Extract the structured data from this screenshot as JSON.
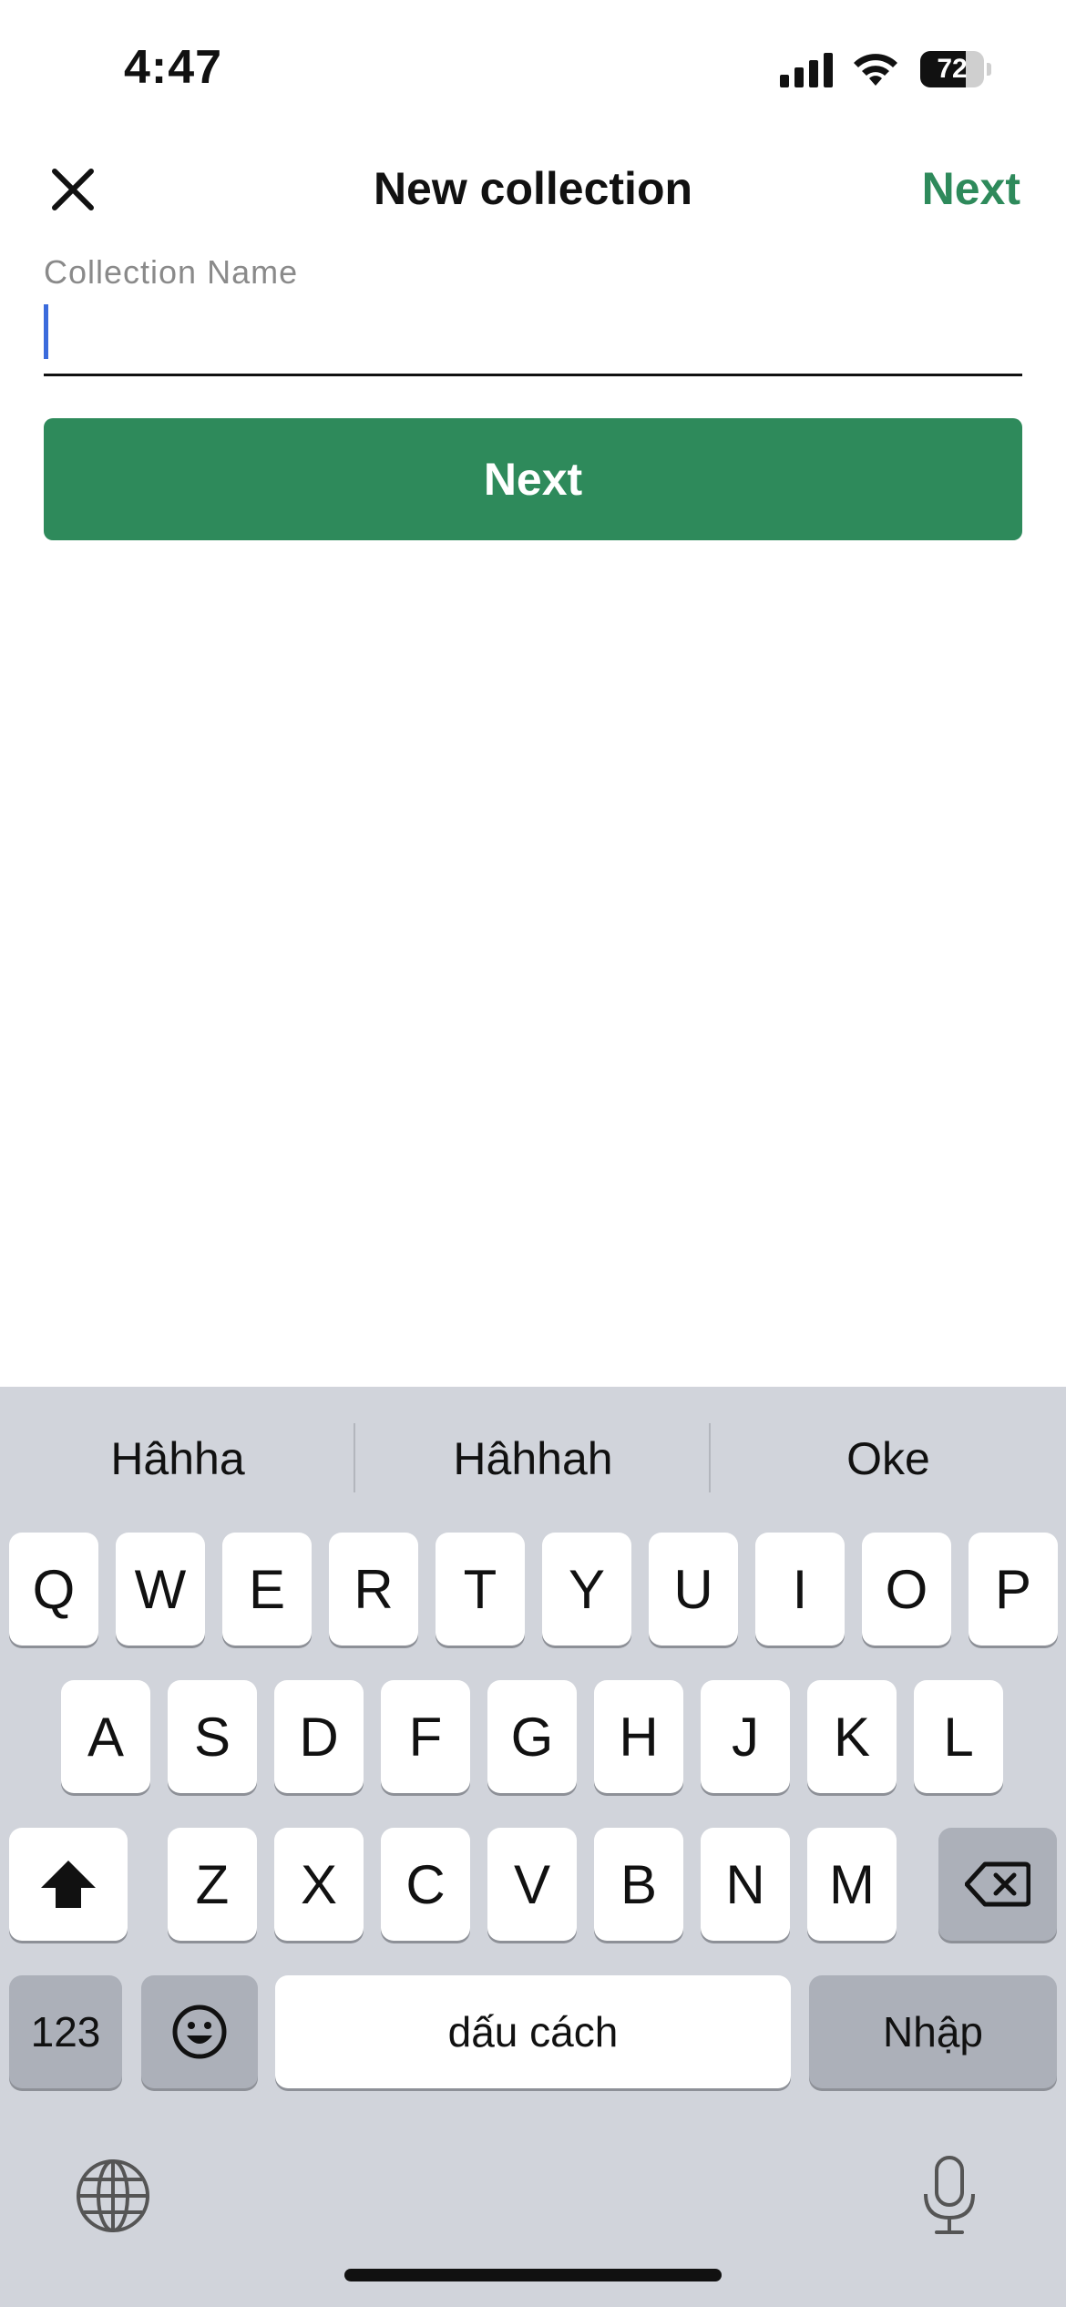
{
  "status_bar": {
    "time": "4:47",
    "battery_level": "72",
    "battery_fraction": 0.72
  },
  "nav": {
    "close_icon": "close-icon",
    "title": "New collection",
    "next_label": "Next"
  },
  "form": {
    "field_label": "Collection Name",
    "field_value": "",
    "button_label": "Next"
  },
  "colors": {
    "brand_green": "#2e8a5b",
    "caret_blue": "#3b6bdc",
    "keyboard_bg": "#d1d4db"
  },
  "keyboard": {
    "suggestions": [
      "Hâhha",
      "Hâhhah",
      "Oke"
    ],
    "row1": [
      "Q",
      "W",
      "E",
      "R",
      "T",
      "Y",
      "U",
      "I",
      "O",
      "P"
    ],
    "row2": [
      "A",
      "S",
      "D",
      "F",
      "G",
      "H",
      "J",
      "K",
      "L"
    ],
    "row3": [
      "Z",
      "X",
      "C",
      "V",
      "B",
      "N",
      "M"
    ],
    "numbers_label": "123",
    "space_label": "dấu cách",
    "return_label": "Nhập",
    "icons": [
      "shift-icon",
      "backspace-icon",
      "emoji-icon",
      "globe-icon",
      "microphone-icon"
    ]
  }
}
